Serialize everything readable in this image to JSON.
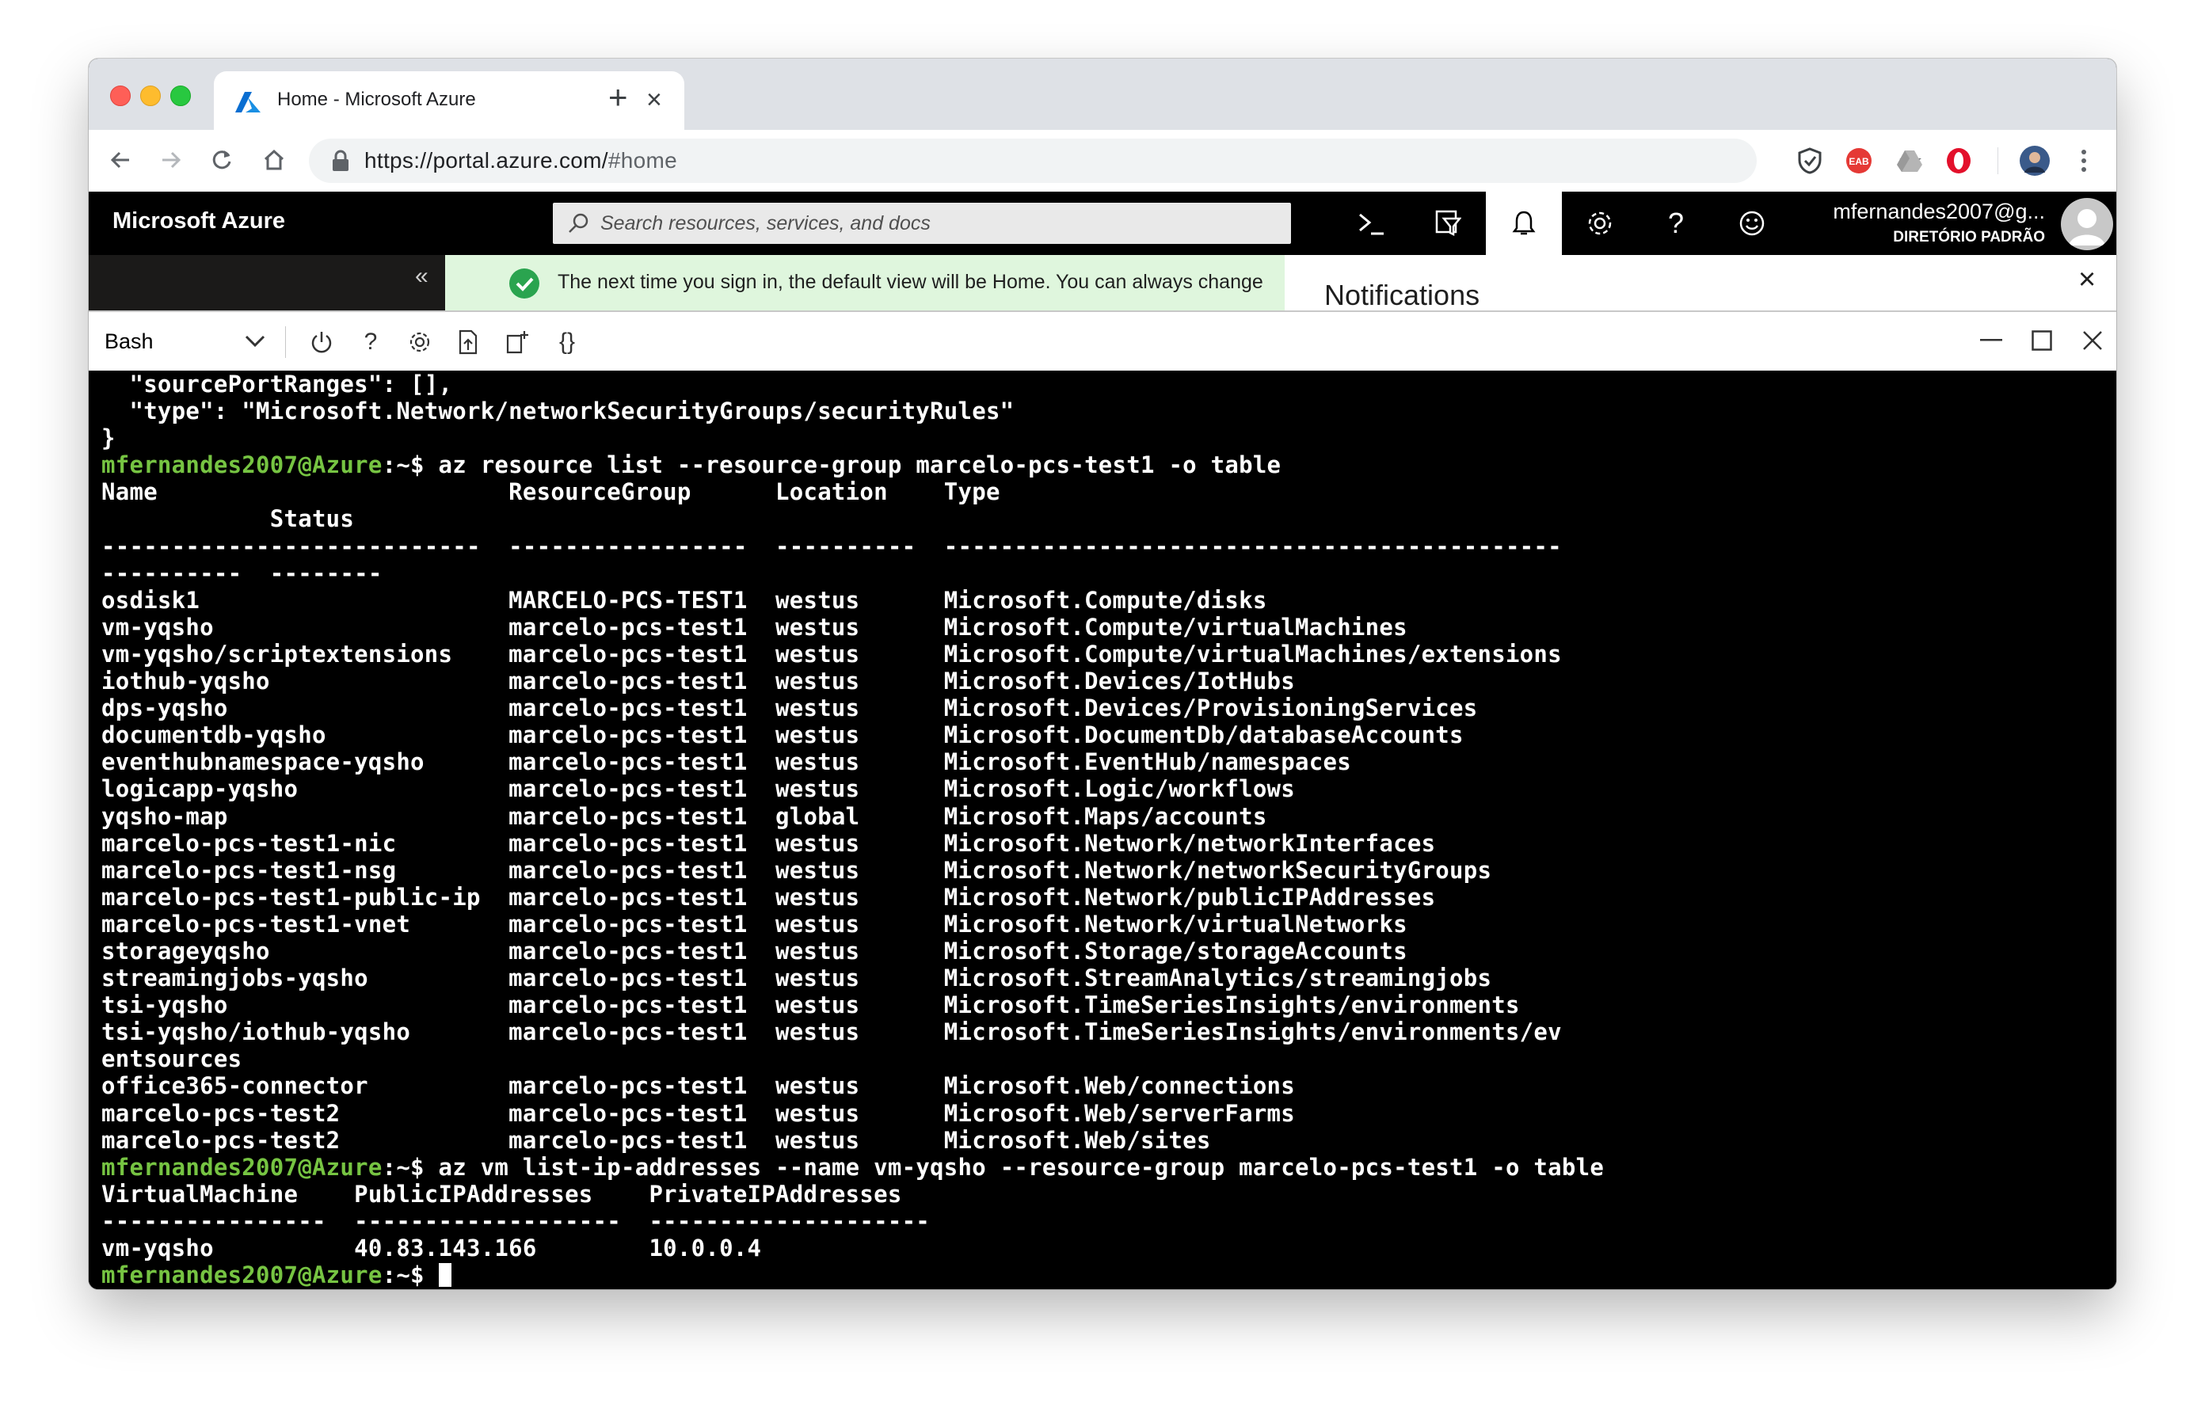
{
  "browser": {
    "tab_title": "Home - Microsoft Azure",
    "url_host": "https://portal.azure.com/",
    "url_path": "#home"
  },
  "azure": {
    "brand": "Microsoft Azure",
    "search_placeholder": "Search resources, services, and docs",
    "user_name": "mfernandes2007@g...",
    "user_directory": "DIRETÓRIO PADRÃO",
    "banner_text": "The next time you sign in, the default view will be Home. You can always change",
    "notifications_title": "Notifications",
    "collapse_label": "«"
  },
  "shell": {
    "selected_shell": "Bash"
  },
  "terminal": {
    "lines": [
      {
        "text": "  \"sourcePortRanges\": [],"
      },
      {
        "text": "  \"type\": \"Microsoft.Network/networkSecurityGroups/securityRules\""
      },
      {
        "text": "}"
      },
      {
        "prompt": "mfernandes2007@Azure",
        "suffix": ":~$ ",
        "text": "az resource list --resource-group marcelo-pcs-test1 -o table"
      },
      {
        "text": "Name                         ResourceGroup      Location    Type"
      },
      {
        "text": "            Status"
      },
      {
        "text": "---------------------------  -----------------  ----------  --------------------------------------------"
      },
      {
        "text": "----------  --------"
      },
      {
        "text": "osdisk1                      MARCELO-PCS-TEST1  westus      Microsoft.Compute/disks"
      },
      {
        "text": "vm-yqsho                     marcelo-pcs-test1  westus      Microsoft.Compute/virtualMachines"
      },
      {
        "text": "vm-yqsho/scriptextensions    marcelo-pcs-test1  westus      Microsoft.Compute/virtualMachines/extensions"
      },
      {
        "text": "iothub-yqsho                 marcelo-pcs-test1  westus      Microsoft.Devices/IotHubs"
      },
      {
        "text": "dps-yqsho                    marcelo-pcs-test1  westus      Microsoft.Devices/ProvisioningServices"
      },
      {
        "text": "documentdb-yqsho             marcelo-pcs-test1  westus      Microsoft.DocumentDb/databaseAccounts"
      },
      {
        "text": "eventhubnamespace-yqsho      marcelo-pcs-test1  westus      Microsoft.EventHub/namespaces"
      },
      {
        "text": "logicapp-yqsho               marcelo-pcs-test1  westus      Microsoft.Logic/workflows"
      },
      {
        "text": "yqsho-map                    marcelo-pcs-test1  global      Microsoft.Maps/accounts"
      },
      {
        "text": "marcelo-pcs-test1-nic        marcelo-pcs-test1  westus      Microsoft.Network/networkInterfaces"
      },
      {
        "text": "marcelo-pcs-test1-nsg        marcelo-pcs-test1  westus      Microsoft.Network/networkSecurityGroups"
      },
      {
        "text": "marcelo-pcs-test1-public-ip  marcelo-pcs-test1  westus      Microsoft.Network/publicIPAddresses"
      },
      {
        "text": "marcelo-pcs-test1-vnet       marcelo-pcs-test1  westus      Microsoft.Network/virtualNetworks"
      },
      {
        "text": "storageyqsho                 marcelo-pcs-test1  westus      Microsoft.Storage/storageAccounts"
      },
      {
        "text": "streamingjobs-yqsho          marcelo-pcs-test1  westus      Microsoft.StreamAnalytics/streamingjobs"
      },
      {
        "text": "tsi-yqsho                    marcelo-pcs-test1  westus      Microsoft.TimeSeriesInsights/environments"
      },
      {
        "text": "tsi-yqsho/iothub-yqsho       marcelo-pcs-test1  westus      Microsoft.TimeSeriesInsights/environments/ev"
      },
      {
        "text": "entsources"
      },
      {
        "text": "office365-connector          marcelo-pcs-test1  westus      Microsoft.Web/connections"
      },
      {
        "text": "marcelo-pcs-test2            marcelo-pcs-test1  westus      Microsoft.Web/serverFarms"
      },
      {
        "text": "marcelo-pcs-test2            marcelo-pcs-test1  westus      Microsoft.Web/sites"
      },
      {
        "prompt": "mfernandes2007@Azure",
        "suffix": ":~$ ",
        "text": "az vm list-ip-addresses --name vm-yqsho --resource-group marcelo-pcs-test1 -o table"
      },
      {
        "text": "VirtualMachine    PublicIPAddresses    PrivateIPAddresses"
      },
      {
        "text": "----------------  -------------------  --------------------"
      },
      {
        "text": "vm-yqsho          40.83.143.166        10.0.0.4"
      },
      {
        "prompt": "mfernandes2007@Azure",
        "suffix": ":~$ ",
        "text": "",
        "cursor": true
      }
    ]
  },
  "colors": {
    "prompt_user": "#76c442",
    "terminal_bg": "#000000",
    "banner_bg": "#dff6dd",
    "banner_check": "#2aa44f"
  },
  "icons": {
    "toolbar": [
      "back-icon",
      "forward-icon",
      "reload-icon",
      "home-icon",
      "lock-icon",
      "star-icon",
      "menu-icon"
    ],
    "azure_header": [
      "cloud-shell-icon",
      "directory-filter-icon",
      "bell-icon",
      "gear-icon",
      "help-icon",
      "feedback-icon"
    ],
    "shell_bar": [
      "power-icon",
      "help-icon",
      "gear-icon",
      "upload-icon",
      "new-session-icon",
      "braces-icon",
      "minimize-icon",
      "maximize-icon",
      "close-icon"
    ]
  }
}
